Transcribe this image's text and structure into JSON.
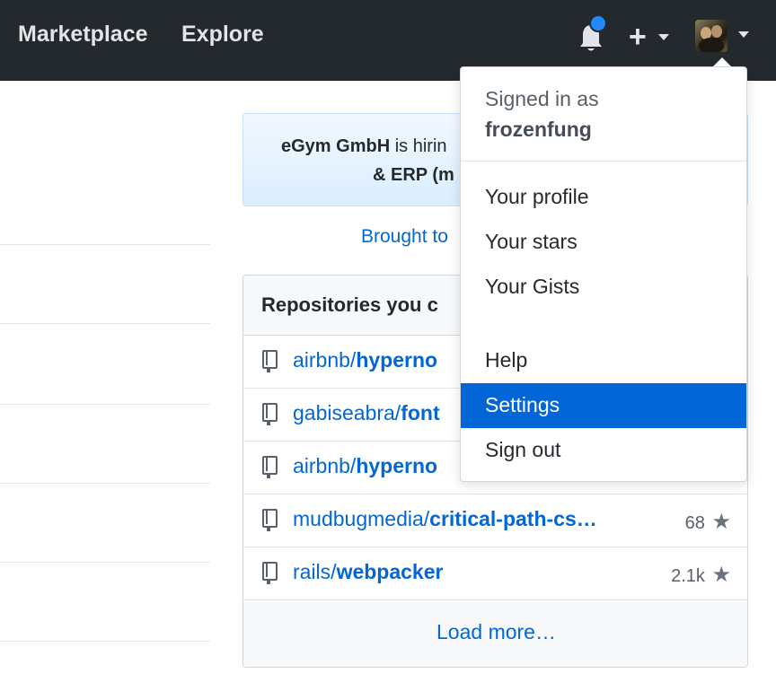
{
  "header": {
    "nav": [
      "Marketplace",
      "Explore"
    ],
    "notification_icon": "bell-icon",
    "create_icon": "plus-icon",
    "avatar_icon": "avatar"
  },
  "promo": {
    "company": "eGym GmbH",
    "line1_rest": " is hirin",
    "line2": "& ERP (m",
    "brought": "Brought to"
  },
  "repositories": {
    "title": "Repositories you c",
    "items": [
      {
        "owner": "airbnb/",
        "name": "hyperno",
        "stars": ""
      },
      {
        "owner": "gabiseabra/",
        "name": "font",
        "stars": ""
      },
      {
        "owner": "airbnb/",
        "name": "hyperno",
        "stars": ""
      },
      {
        "owner": "mudbugmedia/",
        "name": "critical-path-cs…",
        "stars": "68"
      },
      {
        "owner": "rails/",
        "name": "webpacker",
        "stars": "2.1k"
      }
    ],
    "load_more": "Load more…"
  },
  "dropdown": {
    "signed_in_as": "Signed in as",
    "username": "frozenfung",
    "items": [
      "Your profile",
      "Your stars",
      "Your Gists",
      "Help",
      "Settings",
      "Sign out"
    ],
    "active_item": "Settings"
  },
  "colors": {
    "header_bg": "#24292e",
    "link_blue": "#0366d6",
    "notification_dot": "#2188ff",
    "active_item_bg": "#0366d6"
  }
}
